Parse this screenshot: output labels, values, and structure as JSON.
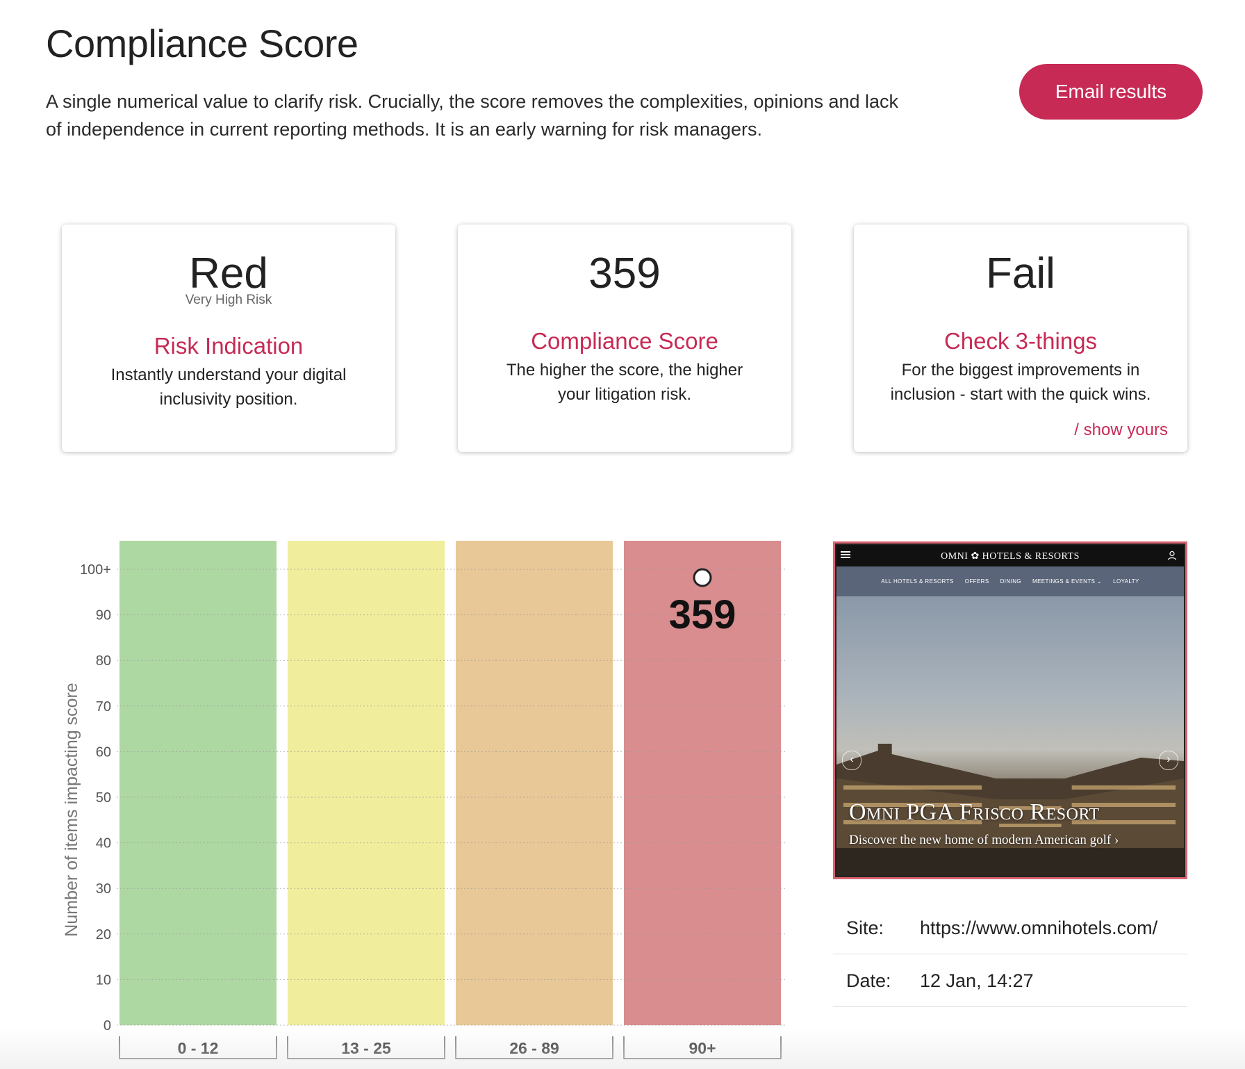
{
  "header": {
    "title": "Compliance Score",
    "intro": "A single numerical value to clarify risk. Crucially, the score removes the complexities, opinions and lack of independence in current reporting methods. It is an early warning for risk managers.",
    "email_label": "Email results"
  },
  "cards": [
    {
      "value": "Red",
      "sub": "Very High Risk",
      "title": "Risk Indication",
      "desc": "Instantly understand your digital inclusivity position."
    },
    {
      "value": "359",
      "title": "Compliance Score",
      "desc": "The higher the score, the higher your litigation risk."
    },
    {
      "value": "Fail",
      "title": "Check 3-things",
      "desc": "For the biggest improvements in inclusion - start with the quick wins.",
      "link": "/ show yours"
    }
  ],
  "chart_data": {
    "type": "bar",
    "ylabel": "Number of items impacting score",
    "xlabel": "",
    "ylim": [
      0,
      100
    ],
    "yticks": [
      "0",
      "10",
      "20",
      "30",
      "40",
      "50",
      "60",
      "70",
      "80",
      "90",
      "100+"
    ],
    "categories": [
      "0 - 12",
      "13 - 25",
      "26 - 89",
      "90+"
    ],
    "band_colors": [
      "#aed8a2",
      "#f0ee9d",
      "#e9c897",
      "#d98d8f"
    ],
    "marker": {
      "category": "90+",
      "value": 100,
      "label": "359"
    },
    "grid": true
  },
  "screenshot": {
    "brand": "OMNI ✿ HOTELS & RESORTS",
    "nav": [
      "ALL HOTELS & RESORTS",
      "OFFERS",
      "DINING",
      "MEETINGS & EVENTS ⌄",
      "LOYALTY"
    ],
    "hero_title": "Omni PGA Frisco Resort",
    "hero_sub": "Discover the new home of modern American golf ›",
    "menu_icon": "hamburger-icon",
    "user_icon": "user-icon"
  },
  "meta": {
    "site_label": "Site:",
    "site_value": "https://www.omnihotels.com/",
    "date_label": "Date:",
    "date_value": "12 Jan, 14:27"
  }
}
